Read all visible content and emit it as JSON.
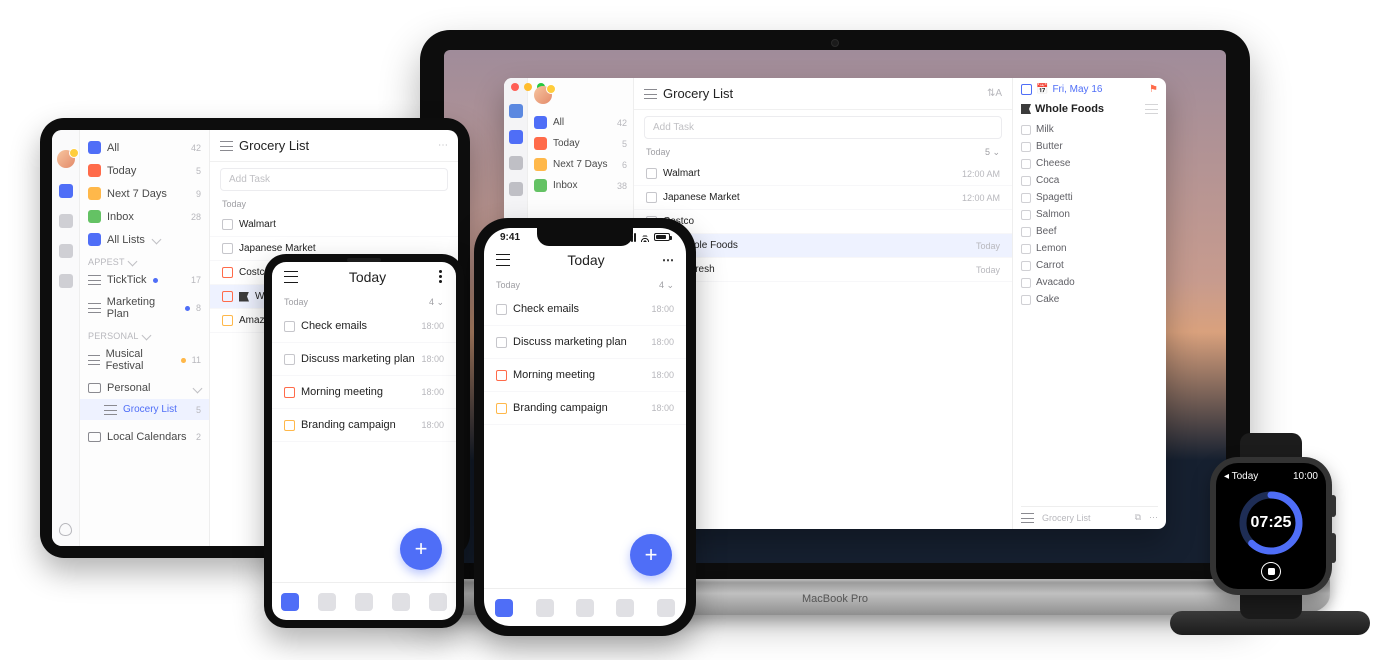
{
  "laptop": {
    "brand": "MacBook Pro",
    "sidebar": {
      "items": [
        {
          "label": "All",
          "count": "42"
        },
        {
          "label": "Today",
          "count": "5"
        },
        {
          "label": "Next 7 Days",
          "count": "6"
        },
        {
          "label": "Inbox",
          "count": "38"
        }
      ]
    },
    "main": {
      "title": "Grocery List",
      "sort_label": "⇅A",
      "add_placeholder": "Add Task",
      "section": {
        "label": "Today",
        "count": "5 ⌄"
      },
      "tasks": [
        {
          "title": "Walmart",
          "time": "12:00 AM"
        },
        {
          "title": "Japanese Market",
          "time": "12:00 AM"
        },
        {
          "title": "Costco",
          "time": ""
        },
        {
          "title": "Whole Foods",
          "time": "Today",
          "flag": true,
          "sel": true
        },
        {
          "title": "Farm Fresh",
          "time": "Today"
        }
      ]
    },
    "detail": {
      "date_label": "Fri, May 16",
      "title": "Whole Foods",
      "items": [
        "Milk",
        "Butter",
        "Cheese",
        "Coca",
        "Spagetti",
        "Salmon",
        "Beef",
        "Lemon",
        "Carrot",
        "Avacado",
        "Cake"
      ],
      "footer_list": "Grocery List"
    }
  },
  "tablet": {
    "sidebar": {
      "smart": [
        {
          "label": "All",
          "count": "42",
          "color": "all"
        },
        {
          "label": "Today",
          "count": "5",
          "color": "today"
        },
        {
          "label": "Next 7 Days",
          "count": "9",
          "color": "next"
        },
        {
          "label": "Inbox",
          "count": "28",
          "color": "inbox"
        }
      ],
      "all_lists": {
        "label": "All Lists",
        "icon": "all"
      },
      "groups": [
        {
          "name": "APPEST",
          "items": [
            {
              "label": "TickTick",
              "count": "17",
              "dot": "b"
            },
            {
              "label": "Marketing Plan",
              "count": "8",
              "dot": "b"
            }
          ]
        },
        {
          "name": "Personal",
          "items": [
            {
              "label": "Musical Festival",
              "count": "11",
              "dot": "y"
            },
            {
              "label": "Personal",
              "folder": true
            },
            {
              "label": "Grocery List",
              "count": "5",
              "child": true,
              "active": true
            }
          ]
        }
      ],
      "calendars": {
        "label": "Local Calendars",
        "count": "2"
      }
    },
    "main": {
      "title": "Grocery List",
      "add_placeholder": "Add Task",
      "section": {
        "label": "Today"
      },
      "tasks": [
        {
          "title": "Walmart",
          "c": ""
        },
        {
          "title": "Japanese Market",
          "c": ""
        },
        {
          "title": "Costco",
          "c": "red"
        },
        {
          "title": "Whole Foods",
          "c": "red",
          "flag": true,
          "sel": true
        },
        {
          "title": "Amazon Fresh",
          "c": "org"
        }
      ]
    }
  },
  "android": {
    "header": "Today",
    "section": {
      "label": "Today",
      "count": "4 ⌄"
    },
    "tasks": [
      {
        "title": "Check emails",
        "time": "18:00",
        "c": ""
      },
      {
        "title": "Discuss marketing plan",
        "time": "18:00",
        "c": ""
      },
      {
        "title": "Morning meeting",
        "time": "18:00",
        "c": "red"
      },
      {
        "title": "Branding campaign",
        "time": "18:00",
        "c": "org"
      }
    ]
  },
  "iphone": {
    "status_time": "9:41",
    "header": "Today",
    "section": {
      "label": "Today",
      "count": "4 ⌄"
    },
    "tasks": [
      {
        "title": "Check emails",
        "time": "18:00",
        "c": ""
      },
      {
        "title": "Discuss marketing plan",
        "time": "18:00",
        "c": ""
      },
      {
        "title": "Morning meeting",
        "time": "18:00",
        "c": "red"
      },
      {
        "title": "Branding campaign",
        "time": "18:00",
        "c": "org"
      }
    ]
  },
  "watch": {
    "back_label": "◂ Today",
    "clock": "10:00",
    "timer": "07:25",
    "progress": 0.62
  }
}
